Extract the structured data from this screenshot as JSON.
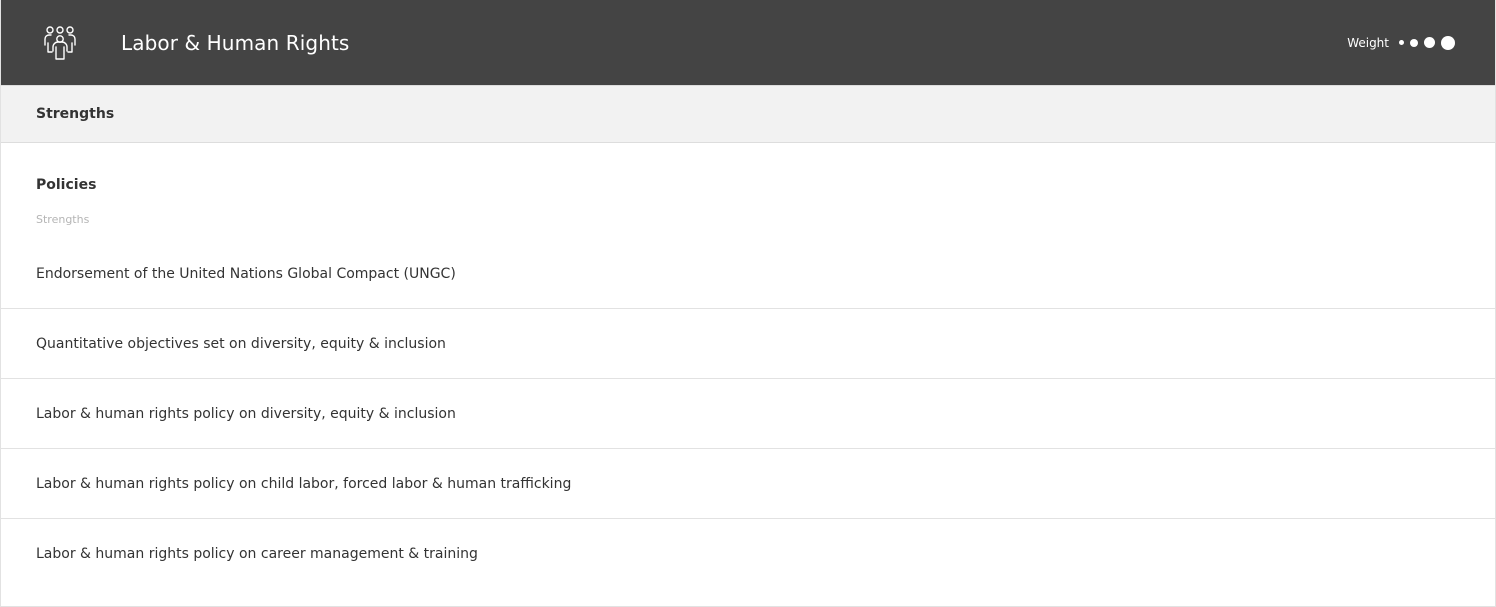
{
  "header": {
    "title": "Labor & Human Rights",
    "icon": "people-group-icon",
    "weight_label": "Weight",
    "weight_level": 4,
    "background": "#444444"
  },
  "section": {
    "label": "Strengths"
  },
  "group": {
    "title": "Policies",
    "subtitle": "Strengths"
  },
  "items": [
    {
      "label": "Endorsement of the United Nations Global Compact (UNGC)"
    },
    {
      "label": "Quantitative objectives set on diversity, equity & inclusion"
    },
    {
      "label": "Labor & human rights policy on diversity, equity & inclusion"
    },
    {
      "label": "Labor & human rights policy on child labor, forced labor & human trafficking"
    },
    {
      "label": "Labor & human rights policy on career management & training"
    }
  ]
}
